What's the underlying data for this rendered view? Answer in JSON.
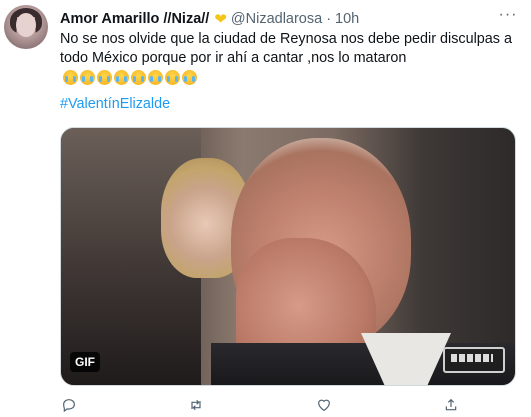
{
  "tweet": {
    "display_name": "Amor Amarillo //Niza//",
    "handle": "@Nizadlarosa",
    "separator": "·",
    "time": "10h",
    "text": "No se nos olvide que la ciudad de Reynosa nos debe pedir disculpas a todo México porque por ir ahí a cantar ,nos lo mataron",
    "hashtag": "#ValentínElizalde",
    "emoji_count": 8,
    "media_badge": "GIF",
    "more_label": "···"
  },
  "icons": {
    "heart_badge": "yellow-heart-icon",
    "crying_emoji": "loudly-crying-face-icon",
    "reply": "reply-icon",
    "retweet": "retweet-icon",
    "like": "like-icon",
    "share": "share-icon",
    "more": "more-options-icon"
  },
  "colors": {
    "link": "#1d9bf0",
    "secondary_text": "#536471",
    "primary_text": "#0f1419",
    "heart": "#f5c518"
  }
}
